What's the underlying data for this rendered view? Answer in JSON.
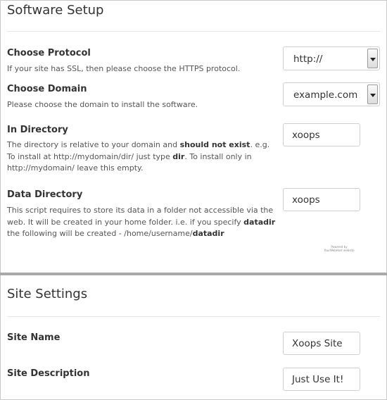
{
  "software_setup": {
    "title": "Software Setup",
    "protocol": {
      "label": "Choose Protocol",
      "help": "If your site has SSL, then please choose the HTTPS protocol.",
      "value": "http://"
    },
    "domain": {
      "label": "Choose Domain",
      "help": "Please choose the domain to install the software.",
      "value": "example.com"
    },
    "directory": {
      "label": "In Directory",
      "help_1": "The directory is relative to your domain and ",
      "help_1_bold": "should not exist",
      "help_2": ". e.g.",
      "help_3": "To install at http://mydomain/dir/ just type ",
      "help_3_bold": "dir",
      "help_4": ". To install only in",
      "help_5": "http://mydomain/ leave this empty.",
      "value": "xoops"
    },
    "data_directory": {
      "label": "Data Directory",
      "help_1": "This script requires to store its data in a folder not accessible via the",
      "help_2": "web. It will be created in your home folder. i.e. if you specify ",
      "help_2_bold": "datadir",
      "help_3": "the following will be created - /home/username/",
      "help_3_bold": "datadir",
      "value": "xoops"
    },
    "watermark_line1": "Powered by",
    "watermark_line2": "YourWebHost website"
  },
  "site_settings": {
    "title": "Site Settings",
    "site_name": {
      "label": "Site Name",
      "value": "Xoops Site"
    },
    "site_description": {
      "label": "Site Description",
      "value": "Just Use It!"
    }
  }
}
